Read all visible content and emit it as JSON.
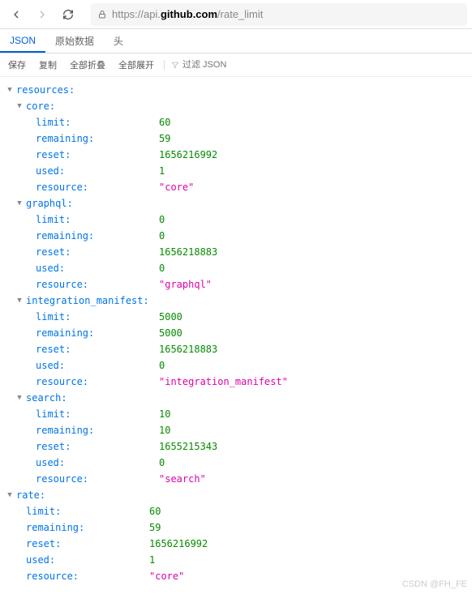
{
  "nav": {
    "url_prefix": "https://api.",
    "url_bold": "github.com",
    "url_suffix": "/rate_limit"
  },
  "tabs": {
    "json": "JSON",
    "raw": "原始数据",
    "headers": "头"
  },
  "toolbar": {
    "save": "保存",
    "copy": "复制",
    "collapse": "全部折叠",
    "expand": "全部展开",
    "filter_placeholder": "过滤 JSON"
  },
  "json": {
    "resources_key": "resources:",
    "sections": [
      {
        "name": "core",
        "limit": "60",
        "remaining": "59",
        "reset": "1656216992",
        "used": "1",
        "resource": "\"core\""
      },
      {
        "name": "graphql",
        "limit": "0",
        "remaining": "0",
        "reset": "1656218883",
        "used": "0",
        "resource": "\"graphql\""
      },
      {
        "name": "integration_manifest",
        "limit": "5000",
        "remaining": "5000",
        "reset": "1656218883",
        "used": "0",
        "resource": "\"integration_manifest\""
      },
      {
        "name": "search",
        "limit": "10",
        "remaining": "10",
        "reset": "1655215343",
        "used": "0",
        "resource": "\"search\""
      }
    ],
    "rate": {
      "name": "rate",
      "limit": "60",
      "remaining": "59",
      "reset": "1656216992",
      "used": "1",
      "resource": "\"core\""
    },
    "labels": {
      "limit": "limit:",
      "remaining": "remaining:",
      "reset": "reset:",
      "used": "used:",
      "resource": "resource:"
    }
  },
  "watermark": "CSDN @FH_FE"
}
